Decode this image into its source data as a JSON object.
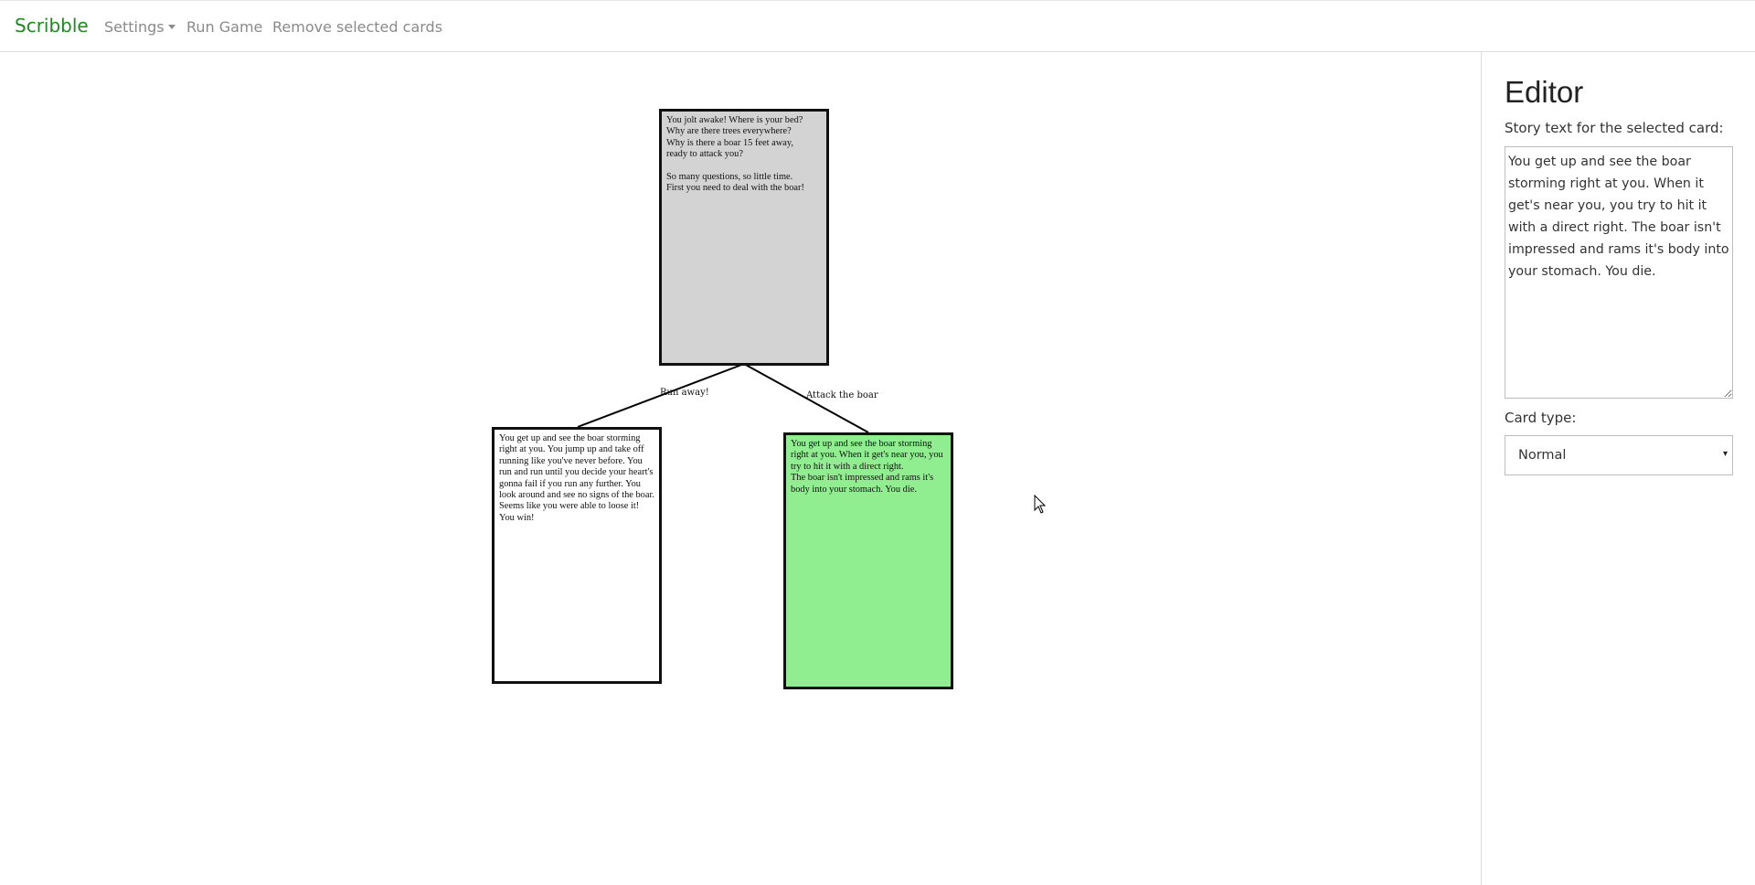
{
  "navbar": {
    "brand": "Scribble",
    "settings_label": "Settings",
    "run_game_label": "Run Game",
    "remove_label": "Remove selected cards"
  },
  "cards": {
    "start": {
      "text": "You jolt awake! Where is your bed?\nWhy are there trees everywhere?\nWhy is there a boar 15 feet away,\nready to attack you?\n\nSo many questions, so little time.\nFirst you need to deal with the boar!",
      "color": "#d3d3d3"
    },
    "win": {
      "text": "You get up and see the boar storming right at you. You jump up and take off running like you've never before. You run and run until you decide your heart's gonna fail if you run any further. You look around and see no signs of the boar. Seems like you were able to loose it! You win!",
      "color": "#ffffff"
    },
    "lose": {
      "text": "You get up and see the boar storming right at you. When it get's near you, you try to hit it with a direct right.\nThe boar isn't impressed and rams it's body into your stomach. You die.",
      "color": "#90ee90"
    }
  },
  "links": {
    "run_away": "Run away!",
    "attack": "Attack the boar"
  },
  "editor": {
    "title": "Editor",
    "story_label": "Story text for the selected card:",
    "story_text": "You get up and see the boar storming right at you. When it get's near you, you try to hit it with a direct right. The boar isn't impressed and rams it's body into your stomach. You die.",
    "card_type_label": "Card type:",
    "card_type_value": "Normal"
  },
  "colors": {
    "brand": "#1e8b1e",
    "nav_link": "#8a8a8a",
    "selected_card": "#90ee90",
    "start_card": "#d3d3d3"
  }
}
